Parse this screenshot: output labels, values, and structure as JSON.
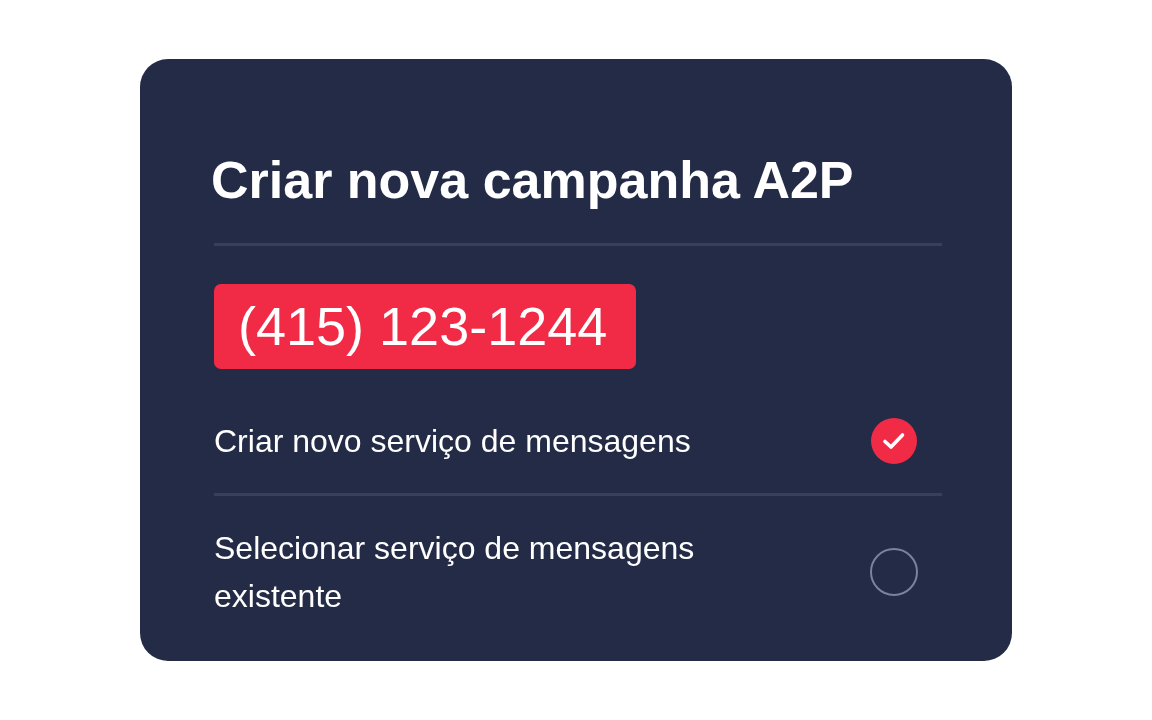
{
  "card": {
    "title": "Criar nova campanha A2P",
    "phone_number": "(415) 123-1244",
    "options": [
      {
        "label": "Criar novo serviço de mensagens",
        "selected": true
      },
      {
        "label": "Selecionar serviço de mensagens existente",
        "selected": false
      }
    ]
  }
}
